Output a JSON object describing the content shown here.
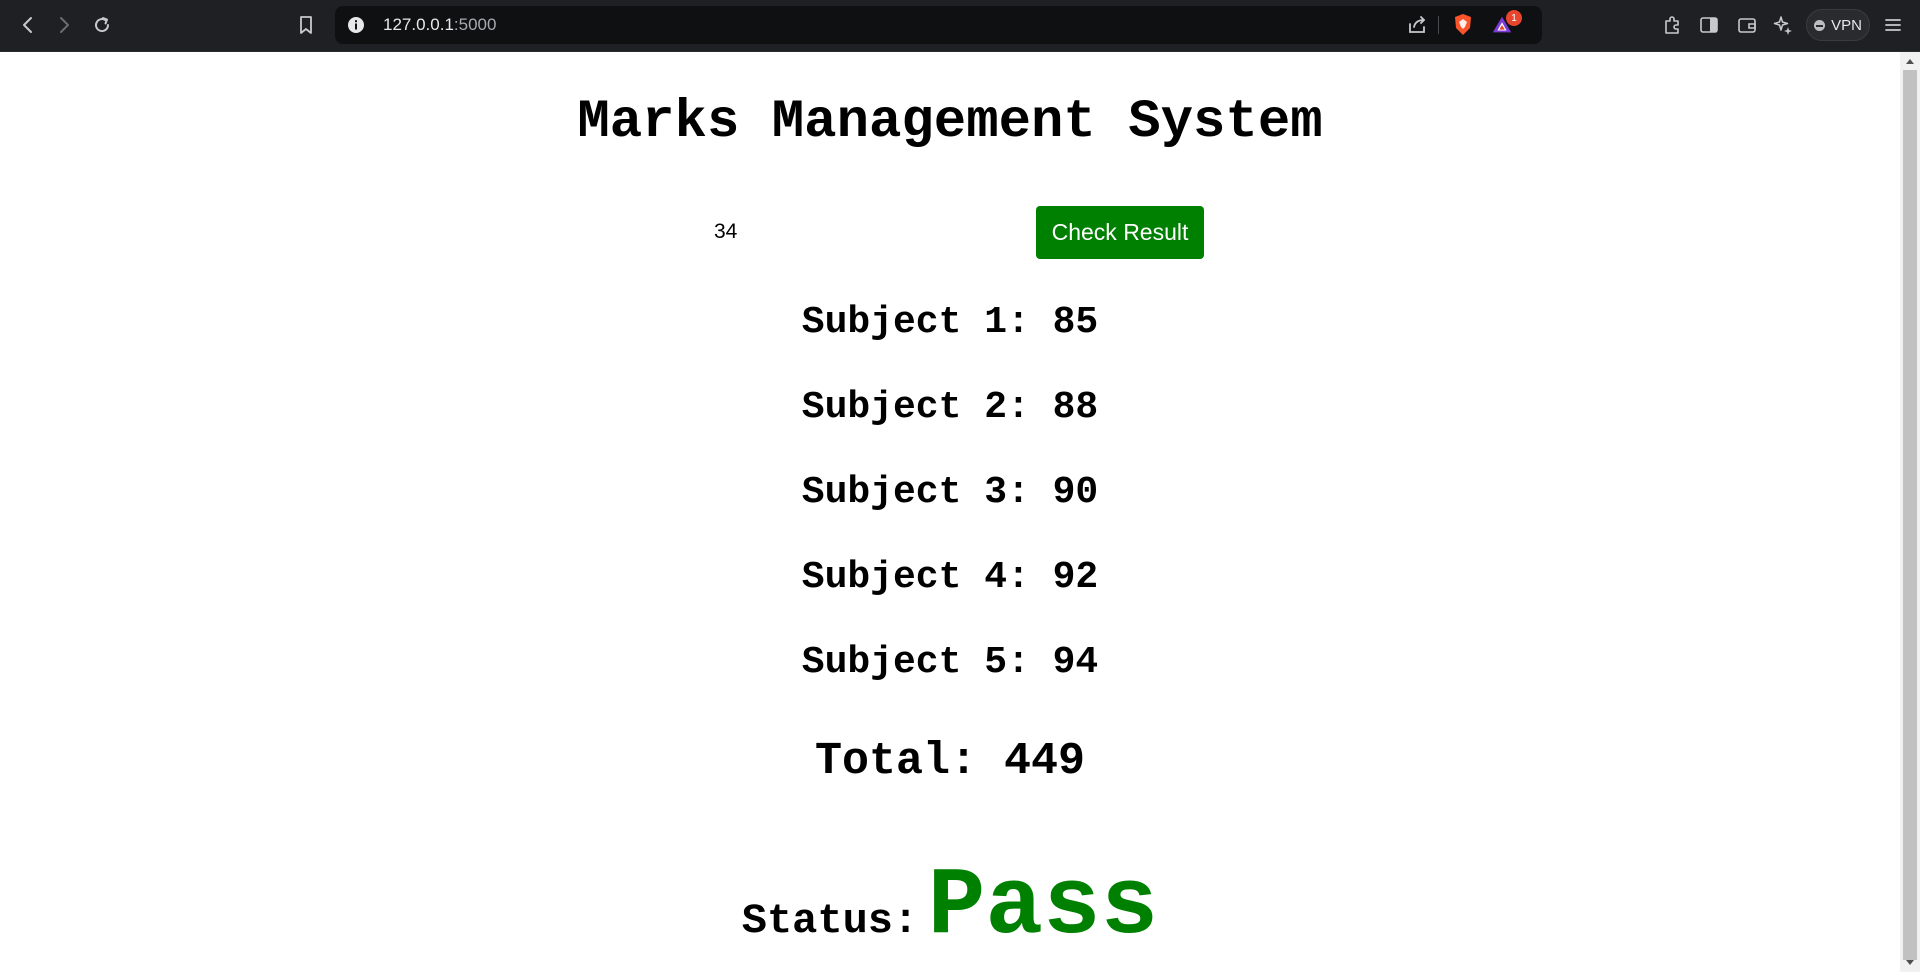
{
  "browser": {
    "url_host": "127.0.0.1",
    "url_port": ":5000",
    "notification_count": "1",
    "vpn_label": "VPN"
  },
  "page": {
    "title": "Marks Management System",
    "roll_input_value": "34",
    "check_button_label": "Check Result",
    "subjects": [
      {
        "label": "Subject 1:",
        "score": "85"
      },
      {
        "label": "Subject 2:",
        "score": "88"
      },
      {
        "label": "Subject 3:",
        "score": "90"
      },
      {
        "label": "Subject 4:",
        "score": "92"
      },
      {
        "label": "Subject 5:",
        "score": "94"
      }
    ],
    "total_label": "Total:",
    "total_value": "449",
    "status_label": "Status:",
    "status_value": "Pass"
  },
  "colors": {
    "accent_green": "#008000",
    "chrome_bg": "#1f2023"
  },
  "icons": [
    "back-icon",
    "forward-icon",
    "reload-icon",
    "bookmark-icon",
    "site-info-icon",
    "share-icon",
    "brave-shield-icon",
    "brave-rewards-icon",
    "extensions-icon",
    "sidebar-icon",
    "wallet-icon",
    "leo-ai-icon",
    "menu-icon"
  ]
}
